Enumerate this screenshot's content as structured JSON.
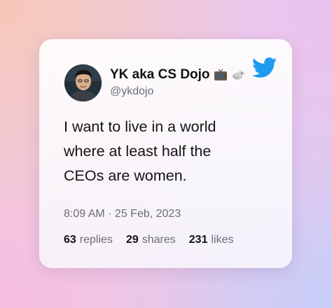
{
  "tweet": {
    "author": {
      "display_name": "YK aka CS Dojo",
      "handle": "@ykdojo",
      "avatar_icon": "profile-photo",
      "name_emojis": [
        "television-emoji",
        "bird-emoji"
      ]
    },
    "brand_icon": "twitter-bird-icon",
    "brand_color": "#1D9BF0",
    "text_lines": [
      "I want to live in a world",
      "where at least half the",
      "CEOs are women."
    ],
    "timestamp": "8:09 AM · 25 Feb, 2023",
    "stats": [
      {
        "count": "63",
        "label": "replies"
      },
      {
        "count": "29",
        "label": "shares"
      },
      {
        "count": "231",
        "label": "likes"
      }
    ]
  }
}
